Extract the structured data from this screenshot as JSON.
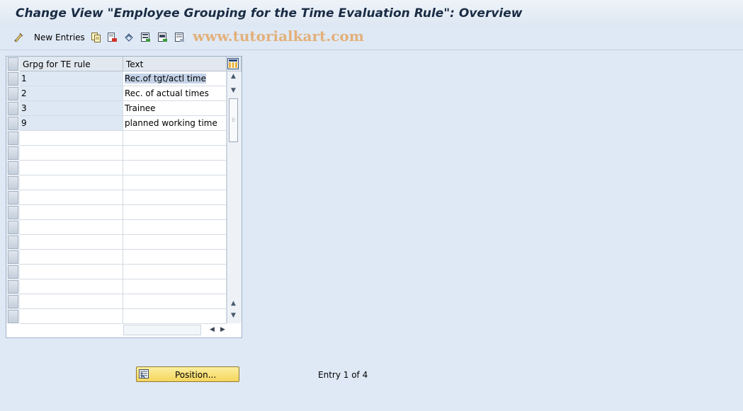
{
  "title": "Change View \"Employee Grouping for the Time Evaluation Rule\": Overview",
  "toolbar": {
    "new_entries_label": "New Entries",
    "watermark": "www.tutorialkart.com",
    "icons": [
      "display-change-icon",
      "copy-icon",
      "delete-icon",
      "undo-icon",
      "select-all-icon",
      "select-block-icon",
      "deselect-all-icon"
    ]
  },
  "table": {
    "columns": [
      "Grpg for TE rule",
      "Text"
    ],
    "rows": [
      {
        "group": "1",
        "text": "Rec.of tgt/actl time"
      },
      {
        "group": "2",
        "text": "Rec. of actual times"
      },
      {
        "group": "3",
        "text": "Trainee"
      },
      {
        "group": "9",
        "text": "planned working time"
      }
    ],
    "visible_row_count": 17
  },
  "position_button_label": "Position...",
  "entry_text": "Entry 1 of 4",
  "colors": {
    "background": "#dfe9f5",
    "key_cell": "#dde8f4",
    "selected_text_bg": "#c4d3e8",
    "button": "#f5d55c"
  }
}
